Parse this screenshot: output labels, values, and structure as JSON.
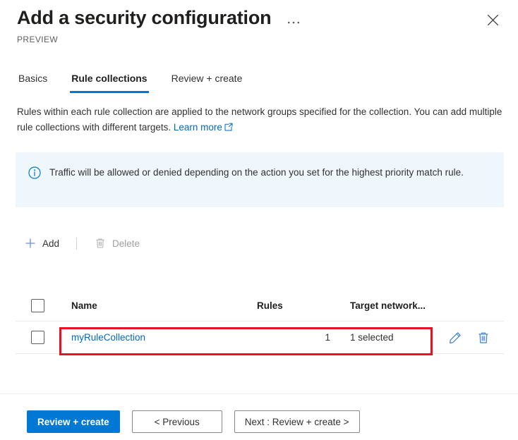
{
  "header": {
    "title": "Add a security configuration",
    "preview_label": "PREVIEW",
    "more_icon": "ellipsis-icon",
    "close_icon": "close-icon"
  },
  "tabs": [
    {
      "label": "Basics",
      "active": false
    },
    {
      "label": "Rule collections",
      "active": true
    },
    {
      "label": "Review + create",
      "active": false
    }
  ],
  "description": {
    "line1": "Rules within each rule collection are applied to the network groups specified for the collection.",
    "line2": "You can add multiple rule collections with different targets.",
    "link_text": "Learn more",
    "link_icon": "external-link-icon"
  },
  "info_banner": {
    "icon": "info-circle-icon",
    "text": "Traffic will be allowed or denied depending on the action you set for the highest priority match rule.",
    "background_color": "#eff6fc",
    "icon_color": "#0078d4"
  },
  "command_bar": {
    "add": {
      "label": "Add",
      "icon": "plus-icon",
      "disabled": false
    },
    "delete": {
      "label": "Delete",
      "icon": "trash-icon",
      "disabled": true
    }
  },
  "table": {
    "select_all_checkbox": "unchecked",
    "columns": [
      "Name",
      "Rules",
      "Target network..."
    ],
    "rows": [
      {
        "checkbox": "unchecked",
        "name": "myRuleCollection",
        "rules": "1",
        "target": "1 selected",
        "edit_icon": "pencil-icon",
        "delete_icon": "trash-icon"
      }
    ]
  },
  "annotation": {
    "color": "#e81123"
  },
  "footer": {
    "primary": "Review + create",
    "previous": "< Previous",
    "next": "Next : Review + create >"
  },
  "colors": {
    "accent": "#0078d4",
    "link": "#0069c0",
    "annotation": "#e81123"
  }
}
